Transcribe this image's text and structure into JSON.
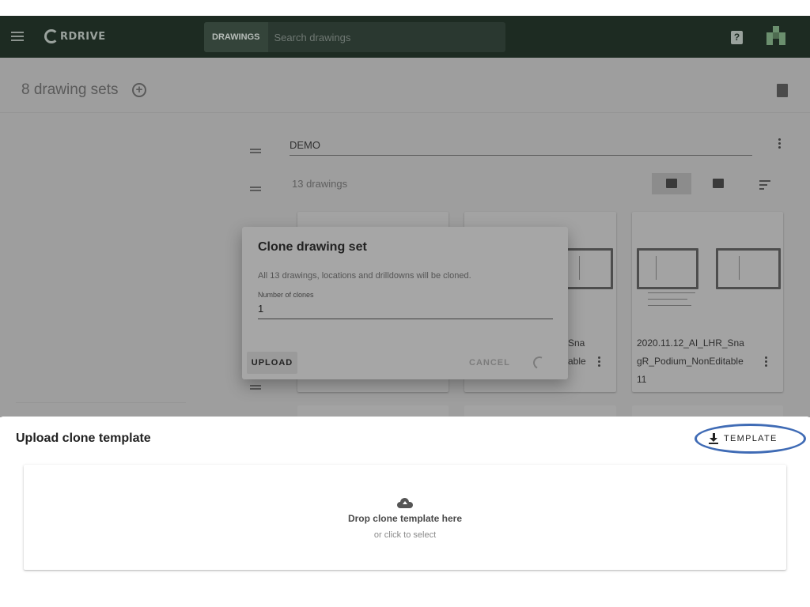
{
  "app": {
    "brand": "RDRIVE",
    "search_chip": "DRAWINGS",
    "search_placeholder": "Search drawings",
    "help_icon": "?"
  },
  "page": {
    "title": "8 drawing sets",
    "add_icon": "+"
  },
  "drawing_set": {
    "name": "DEMO",
    "count": "13 drawings"
  },
  "cards": [
    {
      "name_partial_1": "Sna",
      "name_partial_2": "able"
    },
    {
      "name_line_1": "2020.11.12_AI_LHR_Sna",
      "name_line_2": "gR_Podium_NonEditable",
      "name_line_3": "11"
    }
  ],
  "dialog": {
    "title": "Clone drawing set",
    "description": "All 13 drawings, locations and drilldowns will be cloned.",
    "field_label": "Number of clones",
    "field_value": "1",
    "upload_label": "UPLOAD",
    "cancel_label": "CANCEL"
  },
  "sheet": {
    "title": "Upload clone template",
    "template_label": "TEMPLATE",
    "drop_title": "Drop clone template here",
    "drop_subtitle": "or click to select"
  },
  "colors": {
    "appbar": "#1d2b22",
    "overlay_grey": "#9e9e9e",
    "highlight": "#3f6bb5"
  }
}
